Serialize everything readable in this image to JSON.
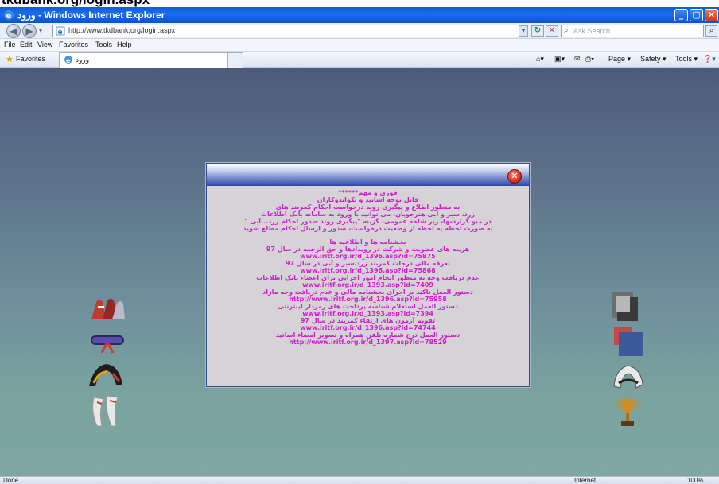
{
  "page_caption": "tkdbank.org/login.aspx",
  "window": {
    "title": "ورود - Windows Internet Explorer",
    "buttons": {
      "minimize": "_",
      "maximize": "▢",
      "close": "✕"
    }
  },
  "address_bar": {
    "url": "http://www.tkdbank.org/login.aspx",
    "search_placeholder": "Ask Search"
  },
  "menu": [
    "File",
    "Edit",
    "View",
    "Favorites",
    "Tools",
    "Help"
  ],
  "favorites_label": "Favorites",
  "tab": {
    "title": "ورود"
  },
  "command_bar": {
    "page": "Page ▾",
    "safety": "Safety ▾",
    "tools": "Tools ▾"
  },
  "dialog": {
    "lines": [
      "فوری و مهم******",
      "قابل توجه اساتید و تکواندوکاران",
      "به منظور اطلاع و پیگیری روند درخواست احکام کمربند های",
      "زرد، سبز و آبی هنرجویان، می توانید با ورود به سامانه بانک اطلاعات",
      "در منو گزارشها، زیر شاخه عمومی، گزینه \"پیگیری روند صدور احکام زرد...آبی \"",
      "به صورت لحظه به لحظه از وضعیت درخواست، صدور و ارسال احکام مطلع شوید",
      "",
      "بخشنامه ها و اطلاعیه ها",
      "هزینه های عضویت و شرکت در رویدادها و حق الزحمه در سال 97",
      "www.iritf.org.ir/d_1396.asp?id=75875",
      "تعرفه مالی درجات کمربند زرد،سبز و آبی در سال 97",
      "www.iritf.org.ir/d_1396.asp?id=75868",
      "عدم دریافت وجه به منظور انجام امور اجرایی برای اعضاء بانک اطلاعات",
      "www.iritf.org.ir/d_1393.asp?id=7409",
      "دستور العمل تاکید بر اجرای بخشنامه مالی و عدم دریافت وجه مازاد",
      "http://www.iritf.org.ir/d_1396.asp?id=75958",
      "دستور العمل استعلام شناسه پرداخت های رمزدار اینترنتی",
      "www.iritf.org.ir/d_1393.asp?id=7394",
      "تقویم آزمون های ارتقاء کمربند در سال 97",
      "www.iritf.org.ir/d_1396.asp?id=74744",
      "دستور العمل درج شماره تلفن همراه و تصویر امضاء اساتید",
      "http://www.iritf.org.ir/d_1397.asp?id=78529"
    ]
  },
  "status_bar": {
    "left": "Done",
    "zone": "Internet",
    "zoom": "100%"
  }
}
